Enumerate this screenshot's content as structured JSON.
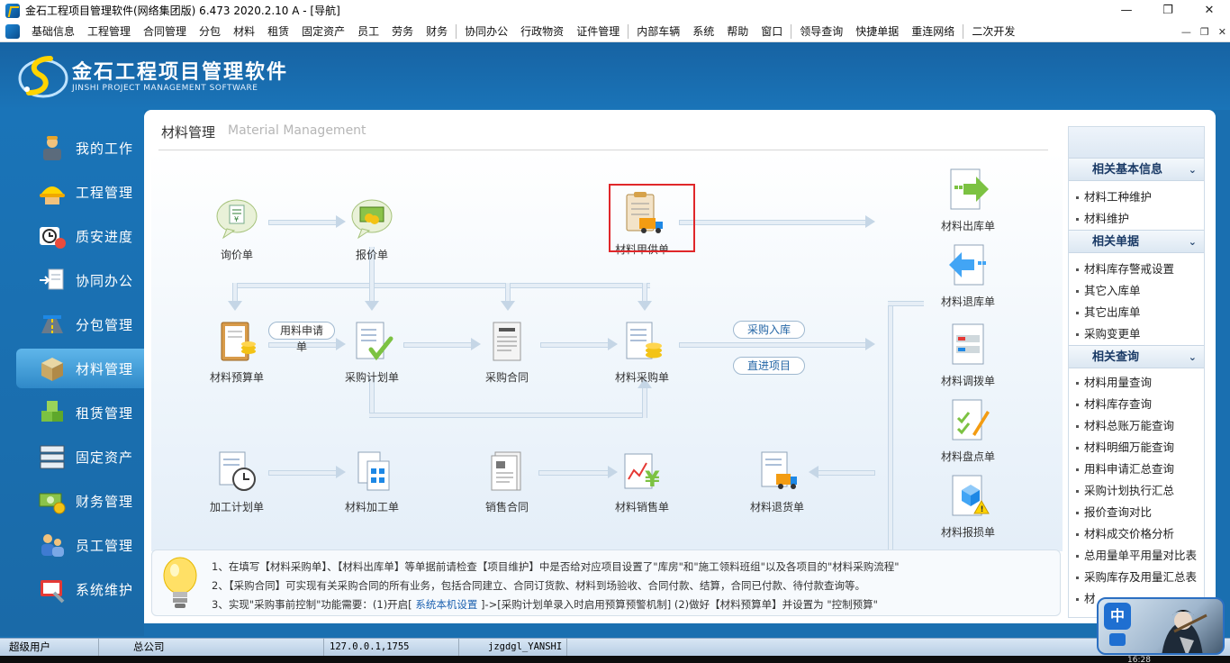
{
  "window": {
    "title": "金石工程项目管理软件(网络集团版) 6.473  2020.2.10 A - [导航]",
    "controls": [
      "—",
      "❐",
      "✕"
    ]
  },
  "menubar": {
    "items": [
      "基础信息",
      "工程管理",
      "合同管理",
      "分包",
      "材料",
      "租赁",
      "固定资产",
      "员工",
      "劳务",
      "财务",
      "协同办公",
      "行政物资",
      "证件管理",
      "内部车辆",
      "系统",
      "帮助",
      "窗口",
      "领导查询",
      "快捷单据",
      "重连网络",
      "二次开发"
    ],
    "mdi_controls": [
      "—",
      "❐",
      "✕"
    ]
  },
  "brand": {
    "name_cn": "金石工程项目管理软件",
    "name_en": "JINSHI PROJECT MANAGEMENT SOFTWARE"
  },
  "sidebar": {
    "items": [
      {
        "label": "我的工作",
        "icon": "worker-icon"
      },
      {
        "label": "工程管理",
        "icon": "hardhat-icon"
      },
      {
        "label": "质安进度",
        "icon": "clock-icon"
      },
      {
        "label": "协同办公",
        "icon": "office-icon"
      },
      {
        "label": "分包管理",
        "icon": "road-icon"
      },
      {
        "label": "材料管理",
        "icon": "box-icon",
        "active": true
      },
      {
        "label": "租赁管理",
        "icon": "cubes-icon"
      },
      {
        "label": "固定资产",
        "icon": "server-icon"
      },
      {
        "label": "财务管理",
        "icon": "money-icon"
      },
      {
        "label": "员工管理",
        "icon": "people-icon"
      },
      {
        "label": "系统维护",
        "icon": "tools-icon"
      }
    ]
  },
  "main": {
    "title": "材料管理",
    "subtitle": "Material Management"
  },
  "diagram": {
    "nodes": {
      "inquiry": "询价单",
      "quote": "报价单",
      "owner_supply": "材料甲供单",
      "budget": "材料预算单",
      "purchase_plan": "采购计划单",
      "purchase_contract": "采购合同",
      "purchase_order": "材料采购单",
      "process_plan": "加工计划单",
      "process_order": "材料加工单",
      "sales_contract": "销售合同",
      "sales_order": "材料销售单",
      "return_goods": "材料退货单",
      "outbound": "材料出库单",
      "return_stock": "材料退库单",
      "transfer": "材料调拨单",
      "inventory": "材料盘点单",
      "damage": "材料报损单"
    },
    "pills": {
      "request": "用料申请单",
      "purchase_in": "采购入库",
      "direct_project": "直进项目"
    }
  },
  "tips": {
    "line1": "1、在填写【材料采购单】、【材料出库单】等单据前请检查【项目维护】中是否给对应项目设置了\"库房\"和\"施工领料班组\"以及各项目的\"材料采购流程\"",
    "line2": "2、【采购合同】可实现有关采购合同的所有业务，包括合同建立、合同订货款、材料到场验收、合同付款、结算，合同已付款、待付款查询等。",
    "line3_a": "3、实现\"采购事前控制\"功能需要：(1)开启[",
    "line3_link": " 系统本机设置 ",
    "line3_b": "]->[采购计划单录入时启用预算预警机制] (2)做好【材料预算单】并设置为 \"控制预算\""
  },
  "right_panel": {
    "sections": [
      {
        "title": "相关基本信息",
        "items": [
          "材料工种维护",
          "材料维护"
        ]
      },
      {
        "title": "相关单据",
        "items": [
          "材料库存警戒设置",
          "其它入库单",
          "其它出库单",
          "采购变更单"
        ]
      },
      {
        "title": "相关查询",
        "items": [
          "材料用量查询",
          "材料库存查询",
          "材料总账万能查询",
          "材料明细万能查询",
          "用料申请汇总查询",
          "采购计划执行汇总",
          "报价查询对比",
          "材料成交价格分析",
          "总用量单平用量对比表",
          "采购库存及用量汇总表",
          "材"
        ]
      }
    ]
  },
  "statusbar": {
    "user": "超级用户",
    "company": "总公司",
    "ip": "127.0.0.1,1755",
    "db": "jzgdgl_YANSHI"
  },
  "avatar": {
    "badge": "中"
  },
  "clock": "16:28",
  "colors": {
    "brand_blue": "#1a6fb0",
    "highlight_red": "#e0272a",
    "link_blue": "#1c61b0"
  }
}
